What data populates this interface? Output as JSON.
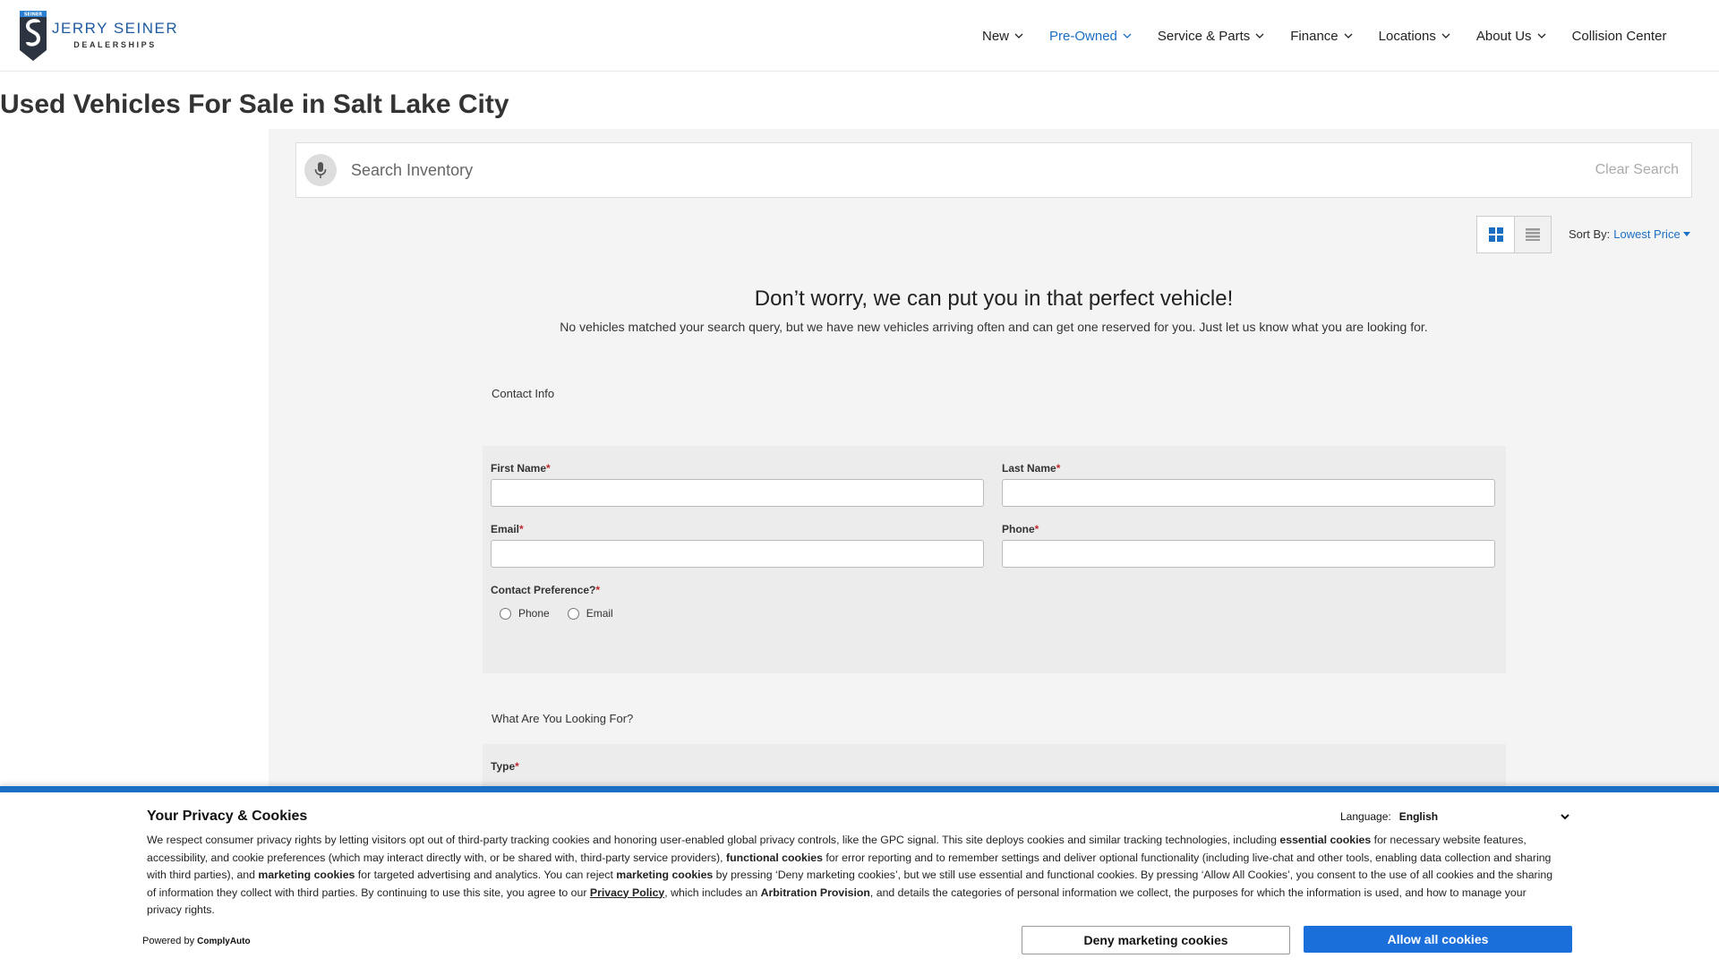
{
  "brand": {
    "name": "JERRY SEINER",
    "tagline": "DEALERSHIPS",
    "shield_text": "SEINER",
    "primary_color": "#1a6fc4"
  },
  "nav": {
    "items": [
      {
        "label": "New",
        "has_dropdown": true
      },
      {
        "label": "Pre-Owned",
        "has_dropdown": true,
        "active": true
      },
      {
        "label": "Service & Parts",
        "has_dropdown": true
      },
      {
        "label": "Finance",
        "has_dropdown": true
      },
      {
        "label": "Locations",
        "has_dropdown": true
      },
      {
        "label": "About Us",
        "has_dropdown": true
      },
      {
        "label": "Collision Center",
        "has_dropdown": false
      }
    ]
  },
  "page": {
    "title": "Used Vehicles For Sale in Salt Lake City"
  },
  "search": {
    "placeholder": "Search Inventory",
    "clear_label": "Clear Search",
    "icon": "microphone-icon"
  },
  "toolbar": {
    "sort_label": "Sort By:",
    "sort_value": "Lowest Price",
    "views": [
      "grid-view-icon",
      "list-view-icon"
    ]
  },
  "empty_state": {
    "title": "Don’t worry, we can put you in that perfect vehicle!",
    "description": "No vehicles matched your search query, but we have new vehicles arriving often and can get one reserved for you. Just let us know what you are looking for."
  },
  "form": {
    "contact_section": "Contact Info",
    "first_name_label": "First Name",
    "last_name_label": "Last Name",
    "email_label": "Email",
    "phone_label": "Phone",
    "contact_pref_label": "Contact Preference?",
    "contact_pref_options": [
      "Phone",
      "Email"
    ],
    "looking_section": "What Are You Looking For?",
    "type_label": "Type",
    "required_mark": "*"
  },
  "cookie": {
    "title": "Your Privacy & Cookies",
    "language_label": "Language:",
    "language_value": "English",
    "text_parts": [
      "We respect consumer privacy rights by letting visitors opt out of third-party tracking cookies and honoring user-enabled global privacy controls, like the GPC signal. This site deploys cookies and similar tracking technologies, including ",
      "essential cookies",
      " for necessary website features, accessibility, and cookie preferences (which may interact directly with, or be shared with, third-party service providers), ",
      "functional cookies",
      " for error reporting and to remember settings and deliver optional functionality (including live-chat and other tools, enabling data collection and sharing with third parties), and ",
      "marketing cookies",
      " for targeted advertising and analytics. You can reject ",
      "marketing cookies",
      " by pressing ‘Deny marketing cookies’, but we still use essential and functional cookies. By pressing ‘Allow All Cookies’, you consent to the use of all cookies and the sharing of information they collect with third parties. By continuing to use this site, you agree to our ",
      "Privacy Policy",
      ", which includes an ",
      "Arbitration Provision",
      ", and details the categories of personal information we collect, the purposes for which the information is used, and how to manage your privacy rights."
    ],
    "powered_by_label": "Powered by",
    "powered_by_brand": "ComplyAuto",
    "deny_label": "Deny marketing cookies",
    "allow_label": "Allow all cookies",
    "allow_color": "#1a6fdb"
  }
}
